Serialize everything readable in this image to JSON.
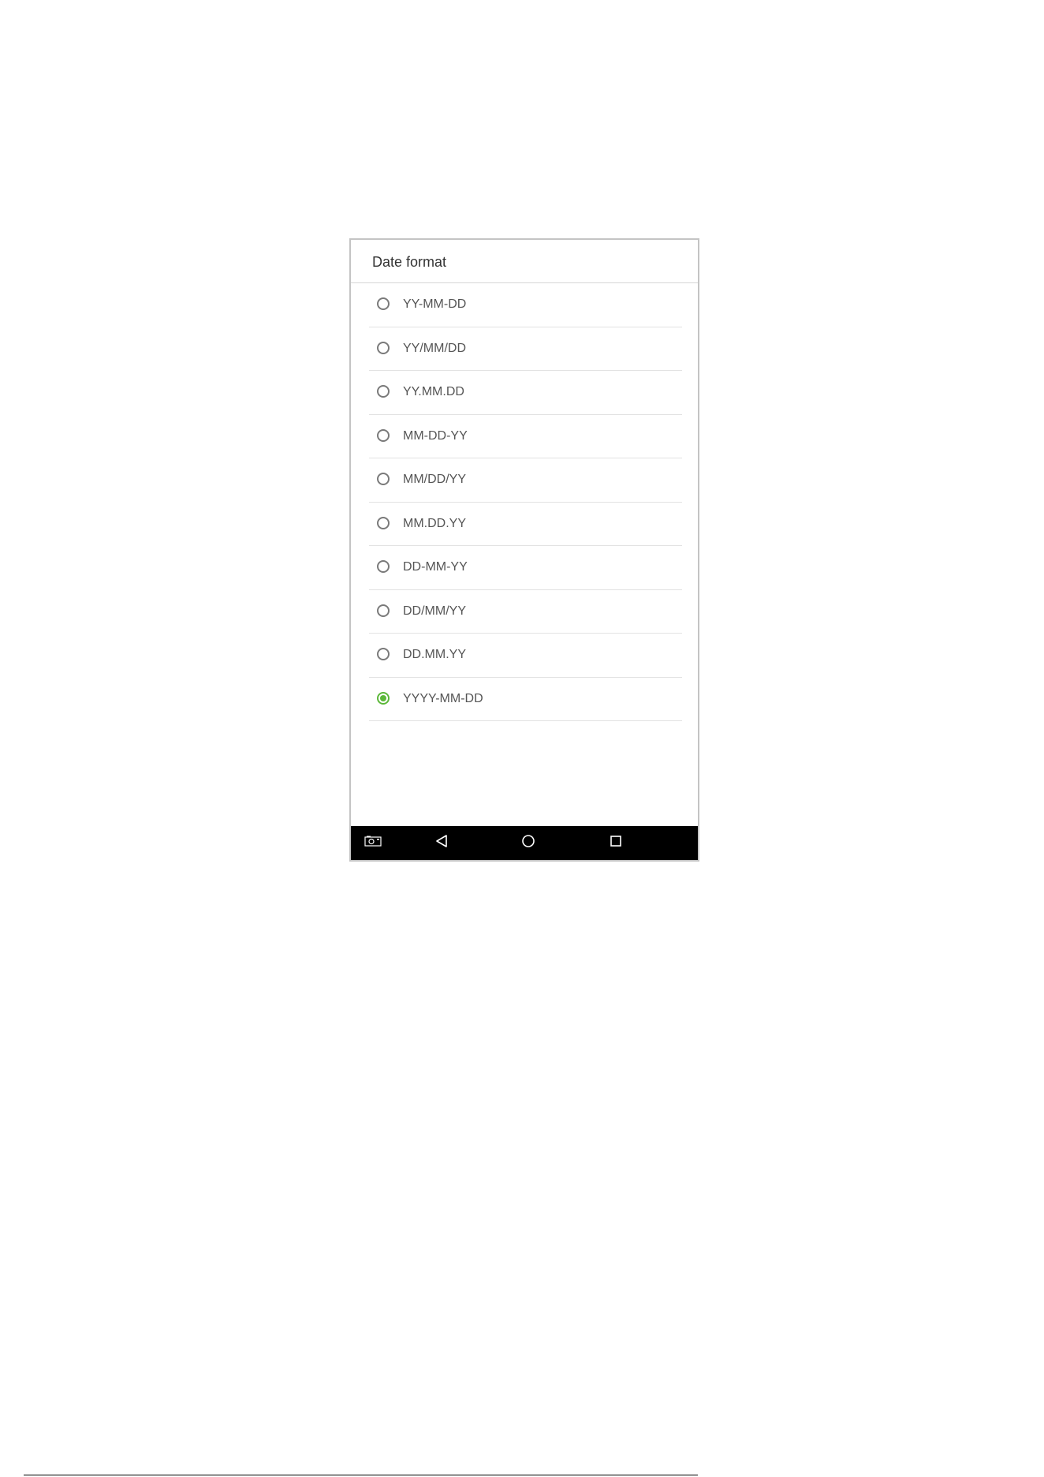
{
  "dialog": {
    "title": "Date format"
  },
  "options": [
    {
      "label": "YY-MM-DD",
      "selected": false
    },
    {
      "label": "YY/MM/DD",
      "selected": false
    },
    {
      "label": "YY.MM.DD",
      "selected": false
    },
    {
      "label": "MM-DD-YY",
      "selected": false
    },
    {
      "label": "MM/DD/YY",
      "selected": false
    },
    {
      "label": "MM.DD.YY",
      "selected": false
    },
    {
      "label": "DD-MM-YY",
      "selected": false
    },
    {
      "label": "DD/MM/YY",
      "selected": false
    },
    {
      "label": "DD.MM.YY",
      "selected": false
    },
    {
      "label": "YYYY-MM-DD",
      "selected": true
    }
  ],
  "nav_bar": {
    "icons": [
      "screenshot-icon",
      "back-icon",
      "home-icon",
      "recents-icon"
    ]
  },
  "colors": {
    "accent": "#5cb83a",
    "nav_background": "#000000",
    "text": "#555555"
  }
}
